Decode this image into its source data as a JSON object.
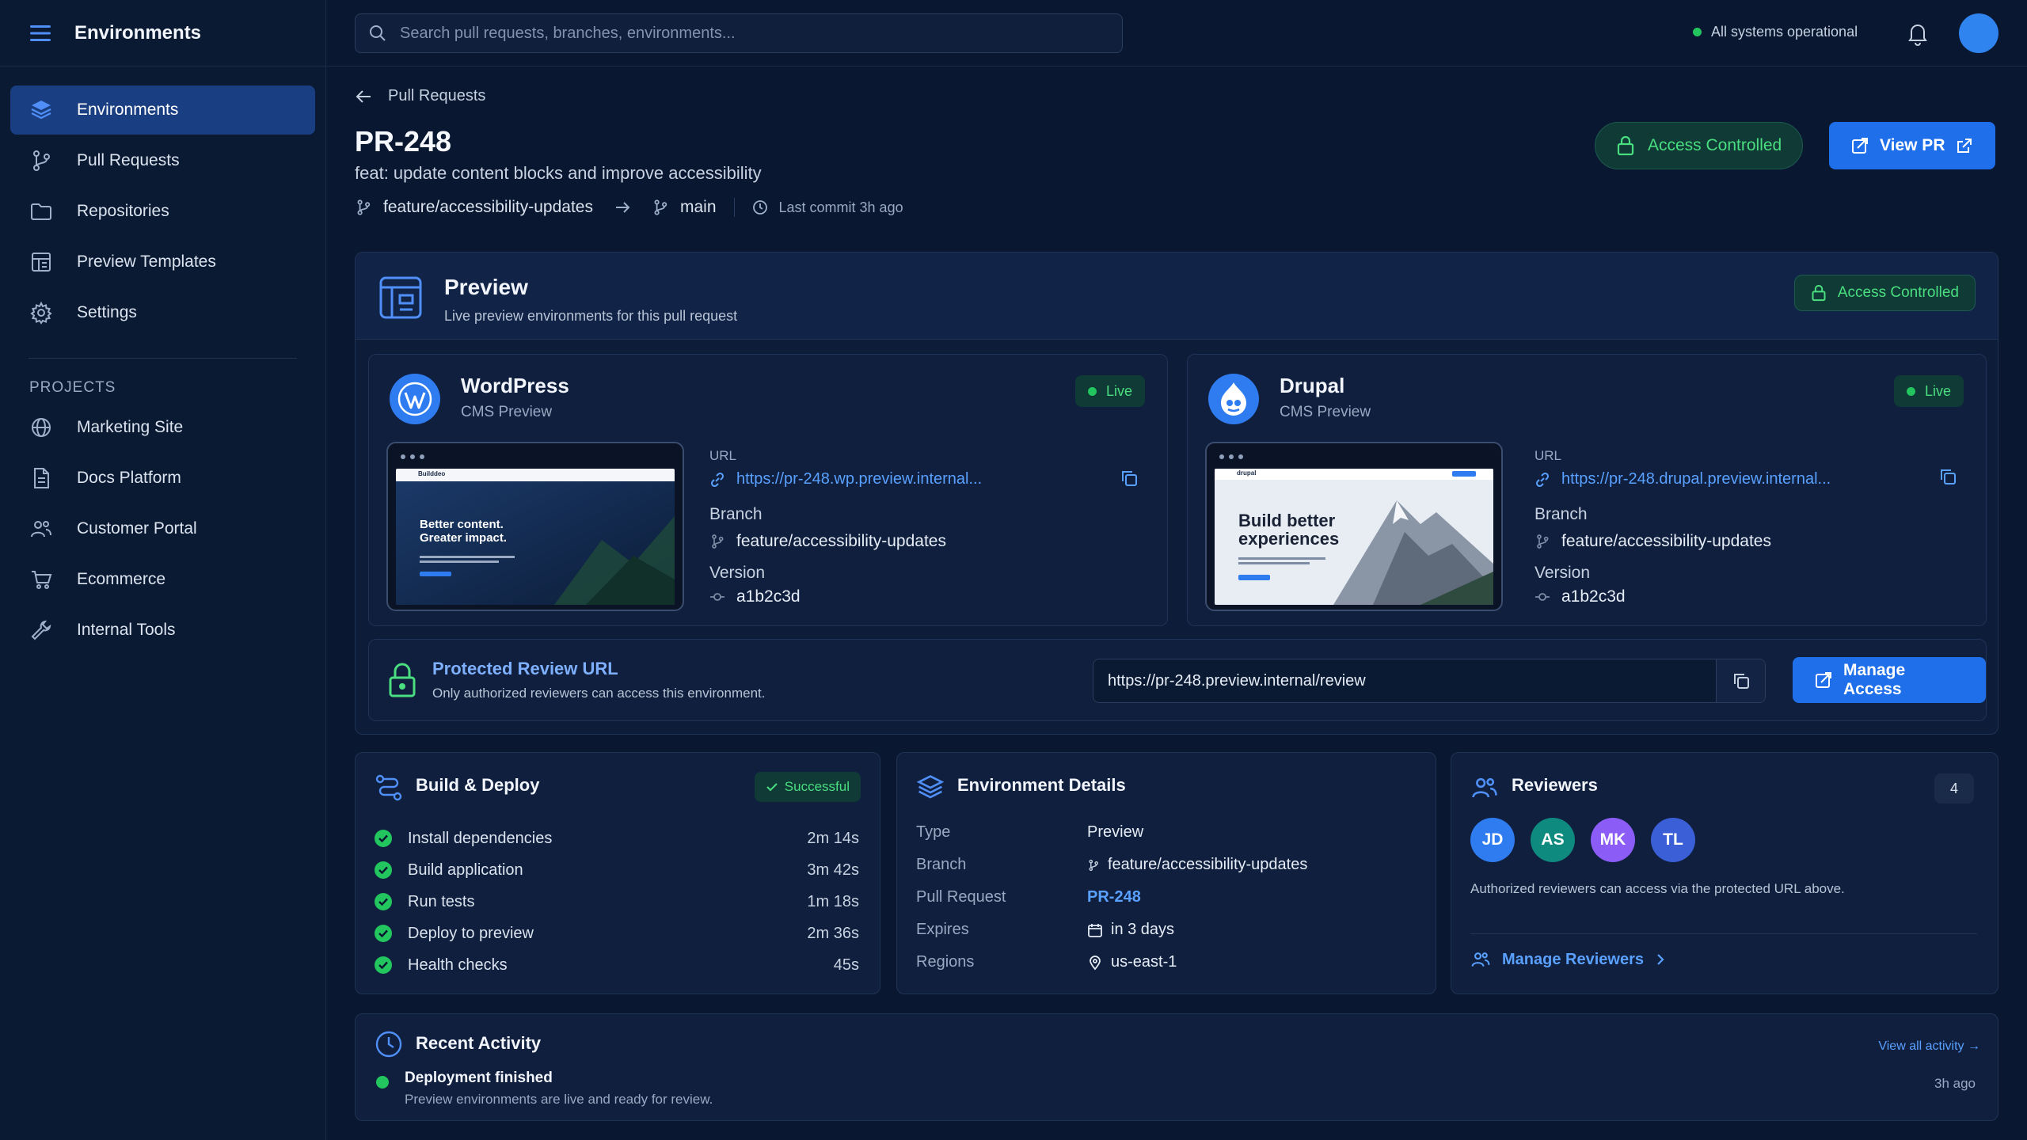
{
  "app": {
    "title": "Environments"
  },
  "sidebar": {
    "items": [
      {
        "label": "Environments",
        "icon": "layers-icon"
      },
      {
        "label": "Pull Requests",
        "icon": "git-branch-icon"
      },
      {
        "label": "Repositories",
        "icon": "folder-icon"
      },
      {
        "label": "Preview Templates",
        "icon": "template-icon"
      },
      {
        "label": "Settings",
        "icon": "gear-icon"
      }
    ],
    "projects_heading": "PROJECTS",
    "projects": [
      {
        "label": "Marketing Site",
        "icon": "globe-icon"
      },
      {
        "label": "Docs Platform",
        "icon": "document-icon"
      },
      {
        "label": "Customer Portal",
        "icon": "users-icon"
      },
      {
        "label": "Ecommerce",
        "icon": "cart-icon"
      },
      {
        "label": "Internal Tools",
        "icon": "wrench-icon"
      }
    ]
  },
  "topbar": {
    "search_placeholder": "Search pull requests, branches, environments...",
    "status": "All systems operational"
  },
  "header": {
    "breadcrumb": "Pull Requests",
    "title": "PR-248",
    "subtitle": "feat: update content blocks and improve accessibility",
    "source_branch": "feature/accessibility-updates",
    "target_branch": "main",
    "last_commit": "Last commit 3h ago",
    "access_label": "Access Controlled",
    "view_pr_label": "View PR"
  },
  "preview": {
    "title": "Preview",
    "subtitle": "Live preview environments for this pull request",
    "access_label": "Access Controlled",
    "environments": [
      {
        "name": "WordPress",
        "type": "CMS Preview",
        "status": "Live",
        "url_label": "URL",
        "url": "https://pr-248.wp.preview.internal...",
        "branch_label": "Branch",
        "branch": "feature/accessibility-updates",
        "version_label": "Version",
        "version": "a1b2c3d",
        "shot_brand": "Builddeo",
        "shot_headline_1": "Better content.",
        "shot_headline_2": "Greater impact."
      },
      {
        "name": "Drupal",
        "type": "CMS Preview",
        "status": "Live",
        "url_label": "URL",
        "url": "https://pr-248.drupal.preview.internal...",
        "branch_label": "Branch",
        "branch": "feature/accessibility-updates",
        "version_label": "Version",
        "version": "a1b2c3d",
        "shot_brand": "drupal",
        "shot_headline_1": "Build better",
        "shot_headline_2": "experiences"
      }
    ],
    "protected": {
      "title": "Protected Review URL",
      "subtitle": "Only authorized reviewers can access this environment.",
      "url": "https://pr-248.preview.internal/review",
      "manage_label": "Manage Access"
    }
  },
  "build": {
    "title": "Build & Deploy",
    "status": "Successful",
    "steps": [
      {
        "label": "Install dependencies",
        "duration": "2m 14s"
      },
      {
        "label": "Build application",
        "duration": "3m 42s"
      },
      {
        "label": "Run tests",
        "duration": "1m 18s"
      },
      {
        "label": "Deploy to preview",
        "duration": "2m 36s"
      },
      {
        "label": "Health checks",
        "duration": "45s"
      }
    ]
  },
  "environment_details": {
    "title": "Environment Details",
    "rows": [
      {
        "key": "Type",
        "value": "Preview"
      },
      {
        "key": "Branch",
        "value": "feature/accessibility-updates"
      },
      {
        "key": "Pull Request",
        "value": "PR-248"
      },
      {
        "key": "Expires",
        "value": "in 3 days"
      },
      {
        "key": "Regions",
        "value": "us-east-1"
      }
    ]
  },
  "reviewers": {
    "title": "Reviewers",
    "count": "4",
    "people": [
      {
        "initials": "JD",
        "color": "#2f7cf0"
      },
      {
        "initials": "AS",
        "color": "#0f8a7e"
      },
      {
        "initials": "MK",
        "color": "#8b5cf6"
      },
      {
        "initials": "TL",
        "color": "#3b5fd6"
      }
    ],
    "note": "Authorized reviewers can access via the protected URL above.",
    "manage_label": "Manage Reviewers"
  },
  "activity": {
    "title": "Recent Activity",
    "view_all": "View all activity →",
    "items": [
      {
        "title": "Deployment finished",
        "subtitle": "Preview environments are live and ready for review.",
        "time": "3h ago"
      }
    ]
  },
  "colors": {
    "accent": "#1f6fea",
    "success": "#22c55e",
    "link": "#5aa0ff",
    "bg": "#0a1730"
  }
}
